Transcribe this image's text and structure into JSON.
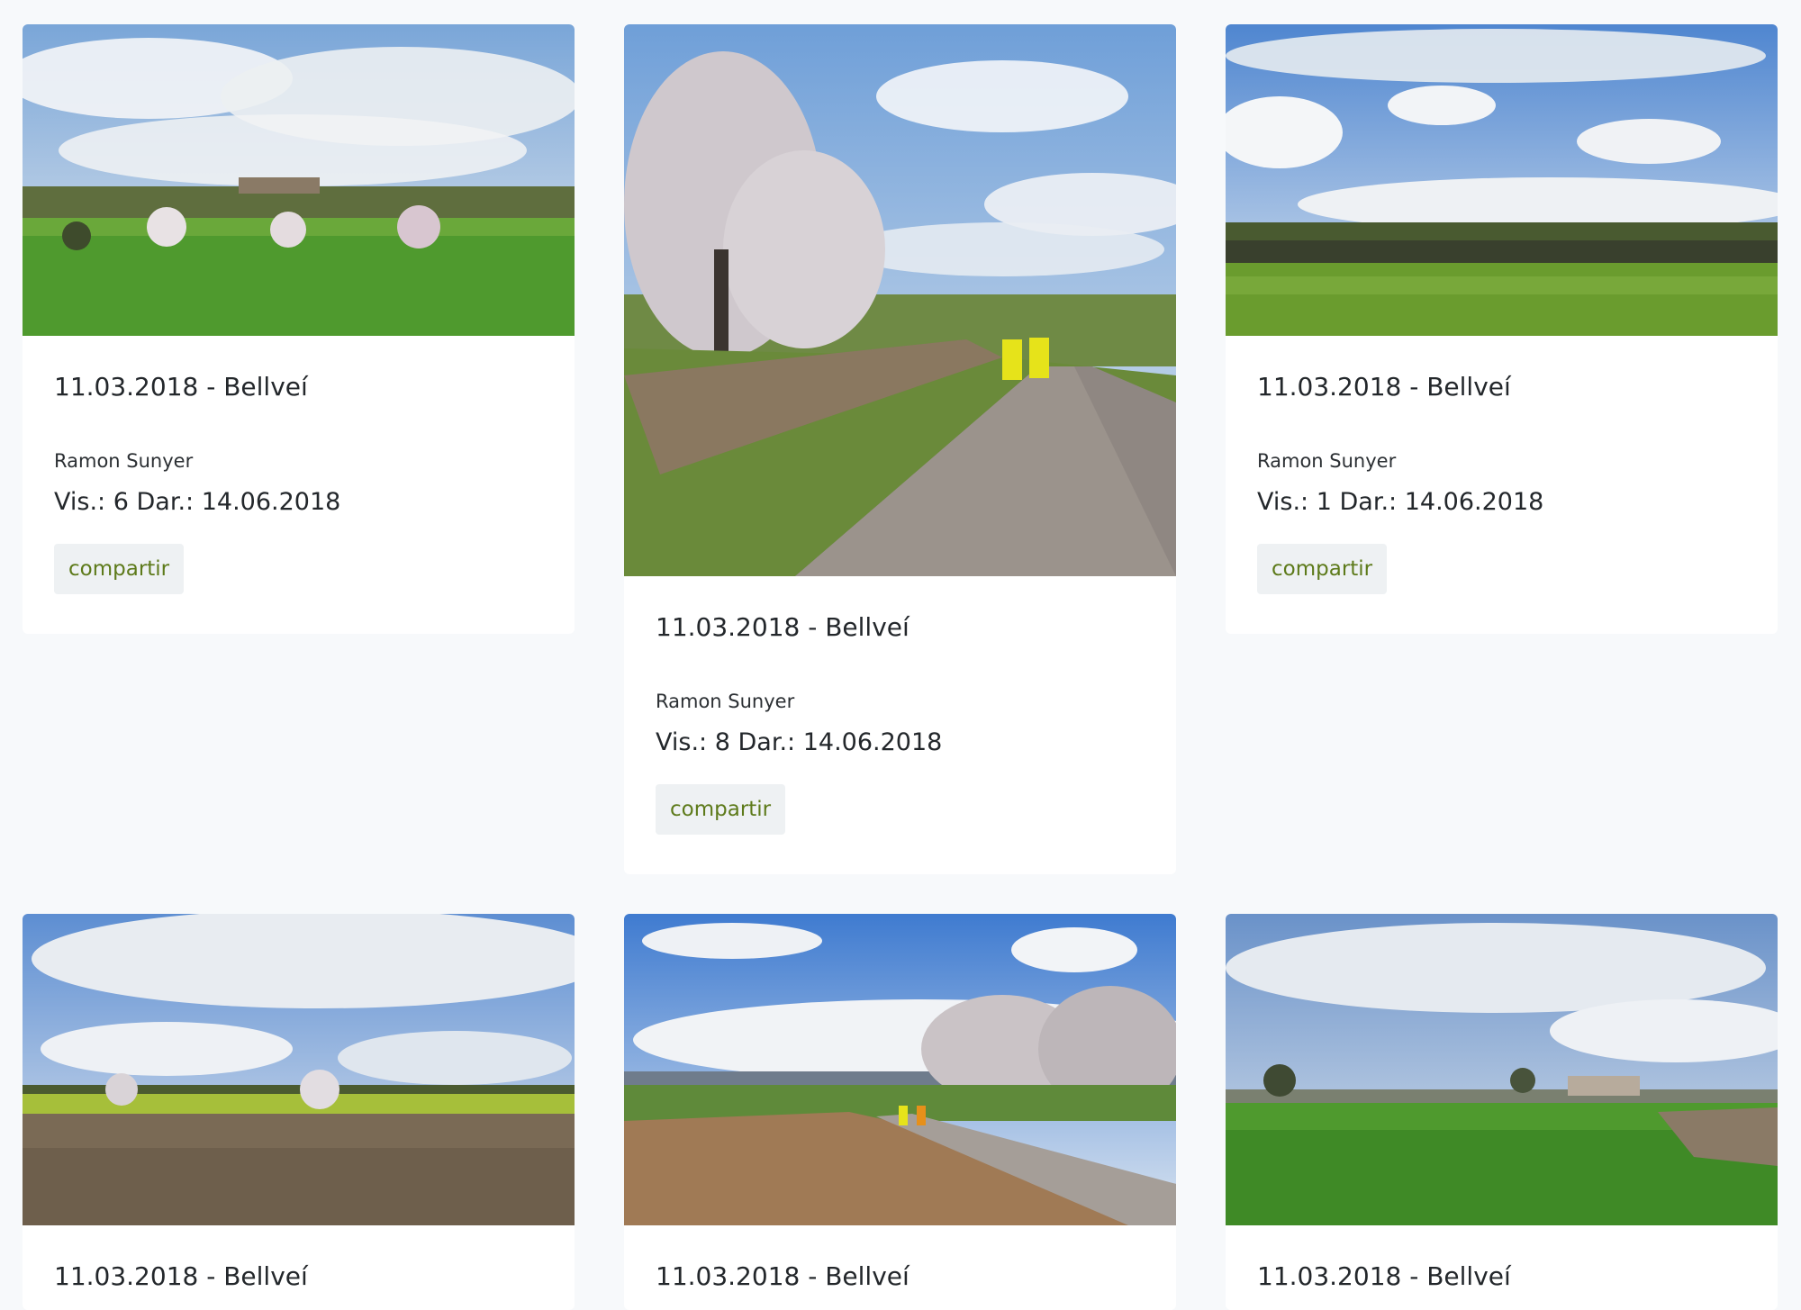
{
  "cards": [
    {
      "title": "11.03.2018 - Bellveí",
      "author": "Ramon Sunyer",
      "vis_label": "Vis.:",
      "vis": "6",
      "dar_label": "Dar.:",
      "dar": "14.06.2018",
      "share_label": "compartir"
    },
    {
      "title": "11.03.2018 - Bellveí",
      "author": "Ramon Sunyer",
      "vis_label": "Vis.:",
      "vis": "8",
      "dar_label": "Dar.:",
      "dar": "14.06.2018",
      "share_label": "compartir"
    },
    {
      "title": "11.03.2018 - Bellveí",
      "author": "Ramon Sunyer",
      "vis_label": "Vis.:",
      "vis": "1",
      "dar_label": "Dar.:",
      "dar": "14.06.2018",
      "share_label": "compartir"
    },
    {
      "title": "11.03.2018 - Bellveí"
    },
    {
      "title": "11.03.2018 - Bellveí"
    },
    {
      "title": "11.03.2018 - Bellveí"
    }
  ],
  "colors": {
    "page_bg": "#f7f9fb",
    "card_bg": "#ffffff",
    "share_text": "#5d7a1a",
    "share_bg": "#eef1f3"
  }
}
